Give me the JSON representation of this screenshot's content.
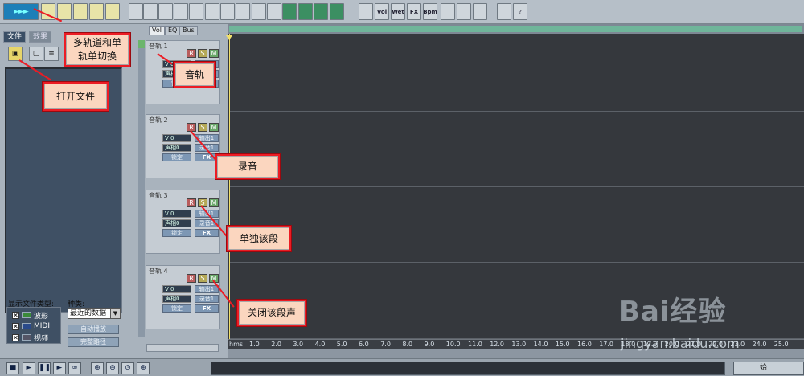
{
  "toolbar": {
    "buttons": [
      {
        "icon": "multitrack-switch-icon",
        "label": "►►►"
      },
      {
        "icon": "new-file-icon",
        "label": ""
      },
      {
        "icon": "open-folder-icon",
        "label": ""
      },
      {
        "icon": "open-append-icon",
        "label": ""
      },
      {
        "icon": "save-icon",
        "label": ""
      },
      {
        "icon": "save-as-icon",
        "label": ""
      },
      {
        "icon": "undo-icon",
        "label": ""
      },
      {
        "icon": "redo-icon",
        "label": ""
      },
      {
        "icon": "copy-icon",
        "label": ""
      },
      {
        "icon": "cut-icon",
        "label": ""
      },
      {
        "icon": "scissors-icon",
        "label": ""
      },
      {
        "icon": "mix-icon",
        "label": ""
      },
      {
        "icon": "waveform-icon",
        "label": ""
      },
      {
        "icon": "envelope-icon",
        "label": ""
      },
      {
        "icon": "grid-icon",
        "label": ""
      },
      {
        "icon": "snap-icon",
        "label": ""
      },
      {
        "icon": "effect-a-icon",
        "label": ""
      },
      {
        "icon": "effect-b-icon",
        "label": ""
      },
      {
        "icon": "effect-c-icon",
        "label": ""
      },
      {
        "icon": "effect-d-icon",
        "label": ""
      },
      {
        "icon": "wave-view-icon",
        "label": ""
      },
      {
        "icon": "vol-icon",
        "label": "Vol"
      },
      {
        "icon": "wet-icon",
        "label": "Wet"
      },
      {
        "icon": "fx-icon",
        "label": "FX"
      },
      {
        "icon": "bpm-icon",
        "label": "Bpm"
      },
      {
        "icon": "cue-icon",
        "label": ""
      },
      {
        "icon": "lock-icon",
        "label": ""
      },
      {
        "icon": "fx-button-icon",
        "label": ""
      },
      {
        "icon": "settings-icon",
        "label": ""
      },
      {
        "icon": "help-icon",
        "label": "?"
      }
    ]
  },
  "left_panel": {
    "tabs": [
      "文件",
      "效果"
    ],
    "file_types_label": "显示文件类型:",
    "kind_label": "种类:",
    "file_types": [
      {
        "checked": true,
        "label": "波形"
      },
      {
        "checked": true,
        "label": "MIDI"
      },
      {
        "checked": true,
        "label": "视频"
      }
    ],
    "sort_value": "最近的数据",
    "autoplay_label": "自动播放",
    "fullpath_label": "完整路径"
  },
  "track_view_tabs": [
    "Vol",
    "EQ",
    "Bus"
  ],
  "tracks": [
    {
      "name": "音轨 1",
      "r": "R",
      "s": "S",
      "m": "M",
      "vol": "V 0",
      "pan": "声相0",
      "out": "输出1",
      "in": "录音1",
      "lock": "锁定",
      "fx": "FX"
    },
    {
      "name": "音轨 2",
      "r": "R",
      "s": "S",
      "m": "M",
      "vol": "V 0",
      "pan": "声相0",
      "out": "输出1",
      "in": "录音1",
      "lock": "锁定",
      "fx": "FX"
    },
    {
      "name": "音轨 3",
      "r": "R",
      "s": "S",
      "m": "M",
      "vol": "V 0",
      "pan": "声相0",
      "out": "输出1",
      "in": "录音1",
      "lock": "锁定",
      "fx": "FX"
    },
    {
      "name": "音轨 4",
      "r": "R",
      "s": "S",
      "m": "M",
      "vol": "V 0",
      "pan": "声相0",
      "out": "输出1",
      "in": "录音1",
      "lock": "锁定",
      "fx": "FX"
    }
  ],
  "ruler": {
    "unit": "hms",
    "ticks": [
      "1.0",
      "2.0",
      "3.0",
      "4.0",
      "5.0",
      "6.0",
      "7.0",
      "8.0",
      "9.0",
      "10.0",
      "11.0",
      "12.0",
      "13.0",
      "14.0",
      "15.0",
      "16.0",
      "17.0",
      "18.0",
      "19.0",
      "20.0",
      "21.0",
      "22.0",
      "23.0",
      "24.0",
      "25.0"
    ]
  },
  "transport": {
    "buttons": [
      {
        "icon": "stop-icon",
        "label": "■"
      },
      {
        "icon": "play-icon",
        "label": "►"
      },
      {
        "icon": "pause-icon",
        "label": "❚❚"
      },
      {
        "icon": "play-to-end-icon",
        "label": "►"
      },
      {
        "icon": "loop-icon",
        "label": "∞"
      },
      {
        "icon": "zoom-in-icon",
        "label": "⊕"
      },
      {
        "icon": "zoom-out-icon",
        "label": "⊖"
      },
      {
        "icon": "zoom-full-icon",
        "label": "⊙"
      },
      {
        "icon": "zoom-selection-icon",
        "label": "⊕"
      }
    ],
    "start_label": "始"
  },
  "callouts": [
    {
      "id": "multitrack-switch",
      "text": "多轨道和单\n轨单切换"
    },
    {
      "id": "open-file",
      "text": "打开文件"
    },
    {
      "id": "audio-track",
      "text": "音轨"
    },
    {
      "id": "record",
      "text": "录音"
    },
    {
      "id": "solo",
      "text": "单独该段"
    },
    {
      "id": "mute",
      "text": "关闭该段声"
    }
  ],
  "watermark": {
    "brand": "Bai经验",
    "domain": "jingyan.baidu.com"
  }
}
